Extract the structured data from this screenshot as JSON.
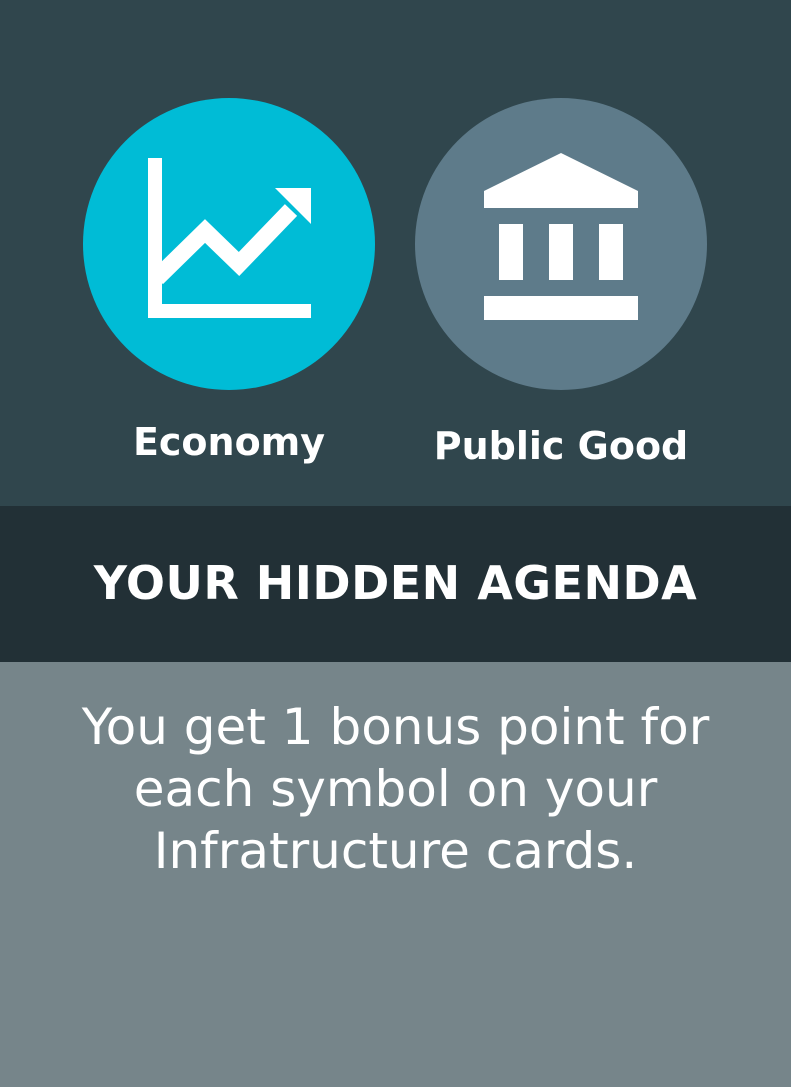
{
  "categories": {
    "economy": {
      "label": "Economy",
      "icon": "chart-trend-up-icon",
      "color": "#00bcd6"
    },
    "public_good": {
      "label": "Public Good",
      "icon": "government-building-icon",
      "color": "#5e7b8a"
    }
  },
  "banner": {
    "title": "YOUR HIDDEN AGENDA"
  },
  "description": {
    "text": "You get 1 bonus point for each symbol on your Infratructure cards."
  },
  "colors": {
    "top_background": "#30464d",
    "banner_background": "#223036",
    "bottom_background": "#76858a",
    "text": "#ffffff"
  }
}
